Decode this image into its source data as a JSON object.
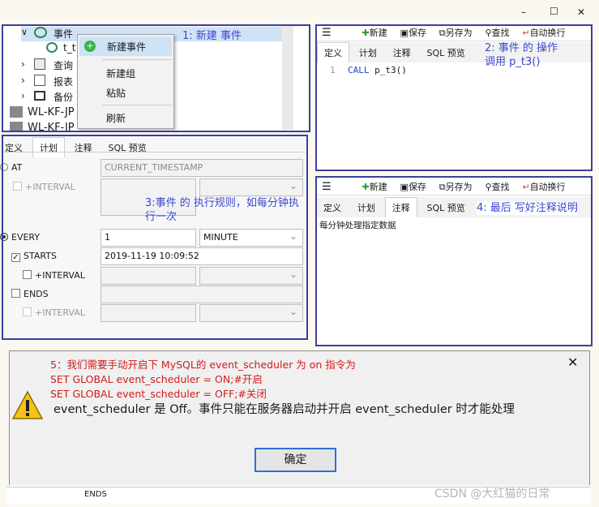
{
  "window_controls": {
    "minimize": "–",
    "maximize": "☐",
    "close": "✕"
  },
  "tree": {
    "event_node": "事件",
    "event_child": "t_t",
    "query_node": "查询",
    "report_node": "报表",
    "backup_node": "备份",
    "conn1": "WL-KF-JP",
    "conn2": "WL-KF-JP"
  },
  "context_menu": {
    "new_event": "新建事件",
    "new_group": "新建组",
    "paste": "粘贴",
    "refresh": "刷新"
  },
  "note1": "1: 新建 事件",
  "schedule_panel": {
    "tabs": [
      "定义",
      "计划",
      "注释",
      "SQL 预览"
    ],
    "at_label": "AT",
    "at_value": "CURRENT_TIMESTAMP",
    "interval_label": "+INTERVAL",
    "every_label": "EVERY",
    "every_value": "1",
    "every_unit": "MINUTE",
    "starts_label": "STARTS",
    "starts_value": "2019-11-19 10:09:52",
    "interval2_label": "+INTERVAL",
    "ends_label": "ENDS",
    "interval3_label": "+INTERVAL"
  },
  "note3": "3:事件 的 执行规则，如每分钟执行一次",
  "editor_top": {
    "toolbar": {
      "new": "新建",
      "save": "保存",
      "save_as": "另存为",
      "find": "查找",
      "wrap": "自动换行"
    },
    "tabs": [
      "定义",
      "计划",
      "注释",
      "SQL 预览"
    ],
    "line_number": "1",
    "code_keyword": "CALL",
    "code_rest": " p_t3()"
  },
  "note2": "2: 事件 的 操作\n调用 p_t3()",
  "editor_bottom": {
    "toolbar": {
      "new": "新建",
      "save": "保存",
      "save_as": "另存为",
      "find": "查找",
      "wrap": "自动换行"
    },
    "tabs": [
      "定义",
      "计划",
      "注释",
      "SQL 预览"
    ],
    "comment_text": "每分钟处理指定数据"
  },
  "note4": "4: 最后 写好注释说明",
  "dialog": {
    "red_line1": "5：我们需要手动开启下 MySQL的 event_scheduler 为 on 指令为",
    "red_line2": "SET GLOBAL event_scheduler = ON;#开启",
    "red_line3": "SET GLOBAL event_scheduler = OFF;#关闭",
    "message": "event_scheduler 是 Off。事件只能在服务器启动并开启 event_scheduler 时才能处理",
    "ok_button": "确定",
    "close": "✕"
  },
  "bottom_strip_label": "ENDS",
  "watermark": "CSDN @大红猫的日常"
}
